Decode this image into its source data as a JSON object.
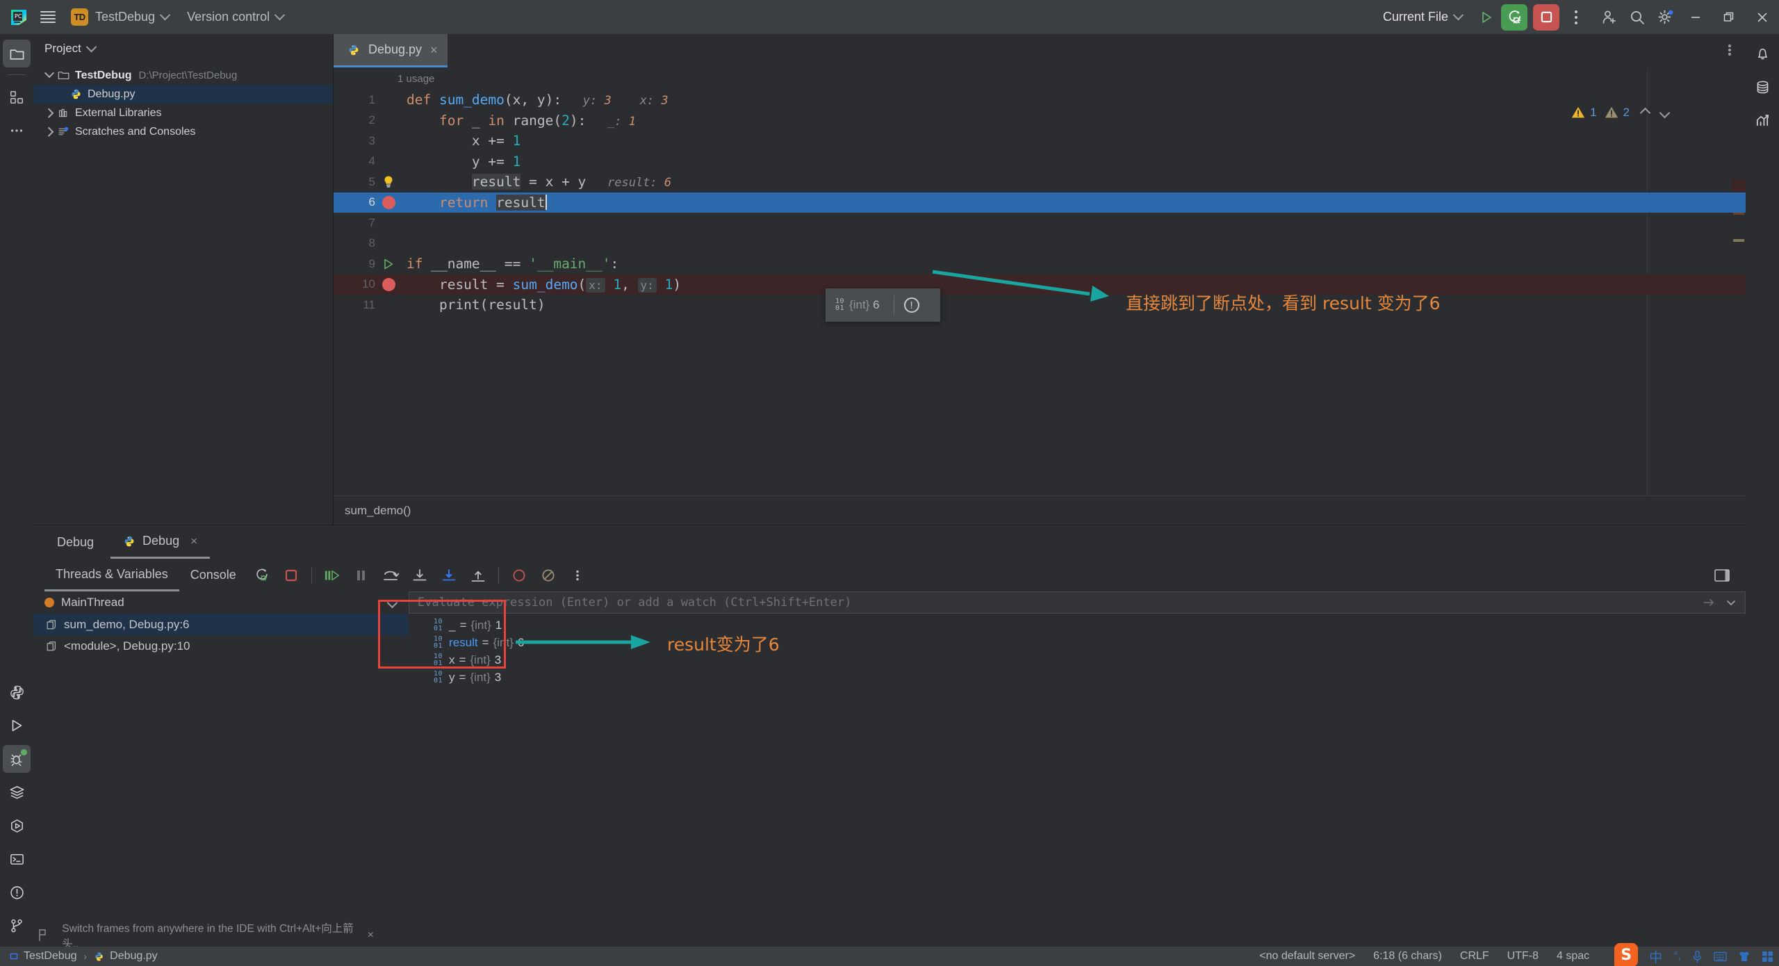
{
  "titlebar": {
    "menu_icon": "hamburger-icon",
    "project_badge": "TD",
    "project_name": "TestDebug",
    "version_control": "Version control",
    "run_config": "Current File",
    "run_icon": "run-icon",
    "debug_icon": "debug-icon",
    "stop_icon": "stop-icon",
    "more_icon": "more-options-icon",
    "account_icon": "add-account-icon",
    "search_icon": "search-icon",
    "settings_icon": "gear-icon",
    "minimize_icon": "minimize-icon",
    "maximize_icon": "maximize-icon",
    "close_icon": "close-icon"
  },
  "project": {
    "title": "Project",
    "tree": [
      {
        "label": "TestDebug",
        "path": "D:\\Project\\TestDebug",
        "icon": "folder-icon",
        "expanded": true,
        "depth": 0,
        "selected": false
      },
      {
        "label": "Debug.py",
        "path": "",
        "icon": "python-file-icon",
        "expanded": null,
        "depth": 1,
        "selected": true
      },
      {
        "label": "External Libraries",
        "path": "",
        "icon": "library-icon",
        "expanded": false,
        "depth": 0,
        "selected": false
      },
      {
        "label": "Scratches and Consoles",
        "path": "",
        "icon": "scratches-icon",
        "expanded": false,
        "depth": 0,
        "selected": false
      }
    ]
  },
  "editor": {
    "tab": {
      "label": "Debug.py",
      "icon": "python-file-icon",
      "close": "×"
    },
    "usage_hint": "1 usage",
    "breadcrumb": "sum_demo()",
    "inspections": {
      "warning_count": "1",
      "weak_warning_count": "2"
    },
    "lines": [
      {
        "num": "1",
        "gutter": "",
        "state": "",
        "tokens": [
          {
            "t": "def ",
            "c": "kw"
          },
          {
            "t": "sum_demo",
            "c": "fn"
          },
          {
            "t": "(x, y):",
            "c": "ident"
          },
          {
            "t": "   y: ",
            "c": "inlay"
          },
          {
            "t": "3",
            "c": "inlay-v"
          },
          {
            "t": "    x: ",
            "c": "inlay"
          },
          {
            "t": "3",
            "c": "inlay-v"
          }
        ]
      },
      {
        "num": "2",
        "gutter": "",
        "state": "",
        "tokens": [
          {
            "t": "    ",
            "c": "ident"
          },
          {
            "t": "for",
            "c": "kw"
          },
          {
            "t": " _ ",
            "c": "ident"
          },
          {
            "t": "in",
            "c": "kw"
          },
          {
            "t": " range(",
            "c": "ident"
          },
          {
            "t": "2",
            "c": "num"
          },
          {
            "t": "):",
            "c": "ident"
          },
          {
            "t": "   _: ",
            "c": "inlay"
          },
          {
            "t": "1",
            "c": "inlay-v"
          }
        ]
      },
      {
        "num": "3",
        "gutter": "",
        "state": "",
        "tokens": [
          {
            "t": "        x += ",
            "c": "ident"
          },
          {
            "t": "1",
            "c": "num"
          }
        ]
      },
      {
        "num": "4",
        "gutter": "",
        "state": "",
        "tokens": [
          {
            "t": "        y += ",
            "c": "ident"
          },
          {
            "t": "1",
            "c": "num"
          }
        ]
      },
      {
        "num": "5",
        "gutter": "bulb-icon",
        "state": "",
        "tokens": [
          {
            "t": "        ",
            "c": "ident"
          },
          {
            "t": "result",
            "c": "sel"
          },
          {
            "t": " = x + y",
            "c": "ident"
          },
          {
            "t": "   result: ",
            "c": "inlay"
          },
          {
            "t": "6",
            "c": "inlay-v"
          }
        ]
      },
      {
        "num": "6",
        "gutter": "breakpoint-icon",
        "state": "exec",
        "tokens": [
          {
            "t": "    ",
            "c": "ident"
          },
          {
            "t": "return",
            "c": "kw"
          },
          {
            "t": " ",
            "c": "ident"
          },
          {
            "t": "result",
            "c": "sel"
          },
          {
            "t": "|",
            "c": "caret"
          }
        ]
      },
      {
        "num": "7",
        "gutter": "",
        "state": "",
        "tokens": []
      },
      {
        "num": "8",
        "gutter": "",
        "state": "",
        "tokens": []
      },
      {
        "num": "9",
        "gutter": "run-icon",
        "state": "",
        "tokens": [
          {
            "t": "if",
            "c": "kw"
          },
          {
            "t": " __name__ == ",
            "c": "ident"
          },
          {
            "t": "'__main__'",
            "c": "str"
          },
          {
            "t": ":",
            "c": "ident"
          }
        ]
      },
      {
        "num": "10",
        "gutter": "breakpoint-icon",
        "state": "bp",
        "tokens": [
          {
            "t": "    result = ",
            "c": "ident"
          },
          {
            "t": "sum_demo",
            "c": "fn"
          },
          {
            "t": "(",
            "c": "ident"
          },
          {
            "t": "x:",
            "c": "phint"
          },
          {
            "t": " ",
            "c": "ident"
          },
          {
            "t": "1",
            "c": "num"
          },
          {
            "t": ", ",
            "c": "ident"
          },
          {
            "t": "y:",
            "c": "phint"
          },
          {
            "t": " ",
            "c": "ident"
          },
          {
            "t": "1",
            "c": "num"
          },
          {
            "t": ")",
            "c": "ident"
          }
        ]
      },
      {
        "num": "11",
        "gutter": "",
        "state": "",
        "tokens": [
          {
            "t": "    print(result)",
            "c": "ident"
          }
        ]
      }
    ],
    "value_tooltip": {
      "binary_icon": "binary-icon",
      "type": "{int}",
      "value": "6",
      "warn_icon": "exclamation-icon"
    },
    "annotation_top": "直接跳到了断点处，看到 result 变为了6"
  },
  "debug_panel": {
    "tabs": [
      {
        "label": "Debug",
        "icon": "",
        "active": false,
        "closable": false
      },
      {
        "label": "Debug",
        "icon": "python-file-icon",
        "active": true,
        "closable": true
      }
    ],
    "subtabs": [
      {
        "label": "Threads & Variables",
        "active": true
      },
      {
        "label": "Console",
        "active": false
      }
    ],
    "toolbar_icons": [
      "rerun-debug-icon",
      "stop-icon",
      "resume-program-icon",
      "pause-program-icon",
      "step-over-icon",
      "step-into-icon",
      "force-step-into-icon",
      "step-out-icon",
      "view-breakpoints-icon",
      "mute-breakpoints-icon",
      "more-options-icon"
    ],
    "split_icon": "layout-split-icon",
    "thread": {
      "name": "MainThread",
      "status_color": "#d47b28"
    },
    "frames": [
      {
        "label": "sum_demo, Debug.py:6",
        "selected": true
      },
      {
        "label": "<module>, Debug.py:10",
        "selected": false
      }
    ],
    "evaluate_placeholder": "Evaluate expression (Enter) or add a watch (Ctrl+Shift+Enter)",
    "variables": [
      {
        "name": "_",
        "type": "{int}",
        "value": "1",
        "highlight": false
      },
      {
        "name": "result",
        "type": "{int}",
        "value": "6",
        "highlight": true
      },
      {
        "name": "x",
        "type": "{int}",
        "value": "3",
        "highlight": false
      },
      {
        "name": "y",
        "type": "{int}",
        "value": "3",
        "highlight": false
      }
    ],
    "annotation_vars": "result变为了6",
    "hint": "Switch frames from anywhere in the IDE with Ctrl+Alt+向上箭头..",
    "hint_close": "×"
  },
  "rails": {
    "left_top": [
      "project-icon",
      "structure-icon",
      "more-tool-windows-icon"
    ],
    "left_bottom": [
      "python-console-icon",
      "run-icon",
      "debug-icon",
      "services-icon",
      "run-anything-icon",
      "terminal-icon",
      "problems-icon",
      "git-icon"
    ],
    "right": [
      "notifications-icon",
      "database-icon",
      "profiler-icon"
    ]
  },
  "statusbar": {
    "breadcrumb": [
      {
        "label": "TestDebug",
        "icon": "module-icon"
      },
      {
        "label": "Debug.py",
        "icon": "python-file-icon"
      }
    ],
    "server": "<no default server>",
    "caret_position": "6:18 (6 chars)",
    "line_separator": "CRLF",
    "encoding": "UTF-8",
    "indent": "4 spac",
    "ime_items": [
      "sogou-icon",
      "chinese-mode-icon",
      "punctuation-icon",
      "voice-input-icon",
      "keyboard-icon",
      "skin-icon",
      "toolbox-icon"
    ]
  },
  "colors": {
    "accent_blue": "#2b6aad",
    "breakpoint_red": "#db5c5c",
    "annotation_orange": "#e8873a",
    "arrow_teal": "#1aa6a0",
    "redbox": "#e8433a",
    "debug_green": "#499c54",
    "stop_red": "#c75450"
  }
}
